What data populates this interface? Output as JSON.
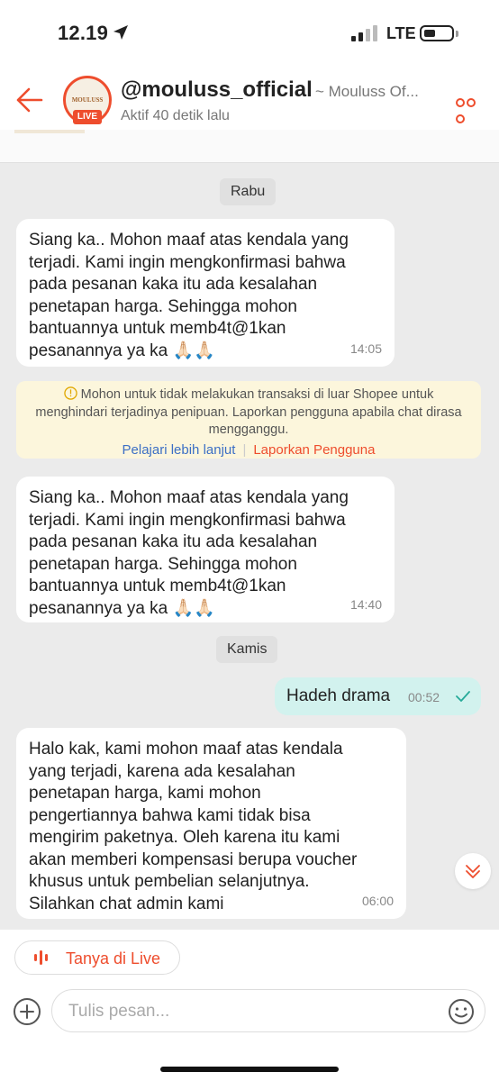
{
  "status_bar": {
    "time": "12.19",
    "network": "LTE"
  },
  "header": {
    "shop_handle": "@mouluss_official",
    "shop_name_suffix": "~ Mouluss Of...",
    "status": "Aktif  40 detik lalu",
    "live_badge": "LIVE",
    "avatar_text": "MOULUSS"
  },
  "chat": {
    "date_1": "Rabu",
    "message_1": {
      "text": "Siang ka.. Mohon maaf atas kendala yang\nterjadi. Kami ingin mengkonfirmasi bahwa\npada pesanan kaka itu ada kesalahan\npenetapan harga. Sehingga mohon\nbantuannya untuk memb4t@1kan\npesanannya ya ka 🙏🏻🙏🏻",
      "time": "14:05"
    },
    "notice": {
      "text": "Mohon untuk tidak melakukan transaksi di luar Shopee untuk menghindari terjadinya penipuan. Laporkan pengguna apabila chat dirasa mengganggu.",
      "learn_more": "Pelajari lebih lanjut",
      "report_user": "Laporkan Pengguna"
    },
    "message_2": {
      "text": "Siang ka.. Mohon maaf atas kendala yang\nterjadi. Kami ingin mengkonfirmasi bahwa\npada pesanan kaka itu ada kesalahan\npenetapan harga. Sehingga mohon\nbantuannya untuk memb4t@1kan\npesanannya ya ka 🙏🏻🙏🏻",
      "time": "14:40"
    },
    "date_2": "Kamis",
    "message_out": {
      "text": "Hadeh drama",
      "time": "00:52"
    },
    "message_3": {
      "text": "Halo kak, kami mohon maaf atas kendala\nyang terjadi, karena ada kesalahan\npenetapan harga, kami mohon\npengertiannya bahwa kami tidak bisa\nmengirim paketnya. Oleh karena itu kami\nakan memberi kompensasi berupa voucher\nkhusus untuk pembelian selanjutnya.\nSilahkan chat admin kami",
      "time": "06:00"
    }
  },
  "composer": {
    "ask_live_label": "Tanya di Live",
    "placeholder": "Tulis pesan..."
  },
  "colors": {
    "accent": "#ee4d2d",
    "outgoing_bubble": "#d2f2ee",
    "notice_bg": "#fcf6dc",
    "link_blue": "#3c6fc5"
  }
}
